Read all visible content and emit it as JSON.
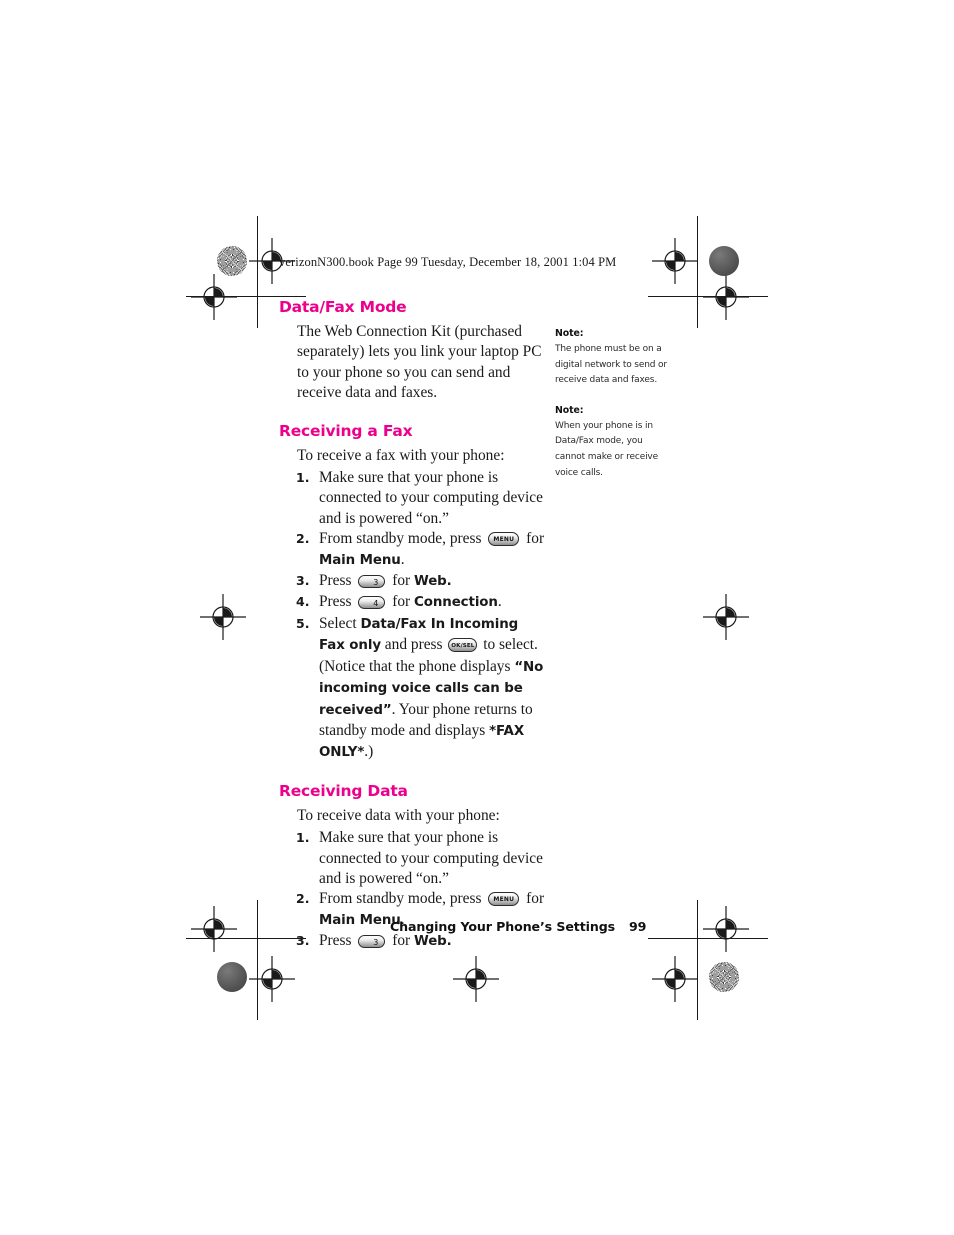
{
  "print_slug": "verizonN300.book  Page 99  Tuesday, December 18, 2001  1:04 PM",
  "accent_color": "#ec008c",
  "sections": [
    {
      "heading": "Data/Fax Mode",
      "intro": "The Web Connection Kit (purchased separately) lets you link your laptop PC to your phone so you can send and receive data and faxes."
    },
    {
      "heading": "Receiving a Fax",
      "intro": "To receive a fax with your phone:",
      "steps": [
        {
          "text_1": "Make sure that your phone is connected to your computing device and is powered “on.”"
        },
        {
          "text_1": "From standby mode, press ",
          "key": "MENU",
          "text_2": " for ",
          "bold_1": "Main Menu",
          "text_3": "."
        },
        {
          "text_1": "Press ",
          "key": "3",
          "text_2": " for ",
          "bold_1": "Web."
        },
        {
          "text_1": "Press ",
          "key": "4",
          "text_2": " for ",
          "bold_1": "Connection",
          "text_3": "."
        },
        {
          "text_1": "Select ",
          "bold_1": "Data/Fax In Incoming Fax only",
          "text_2": " and press ",
          "key": "OK/SEL",
          "text_3": " to select. (Notice that the phone displays ",
          "bold_2": "“No incoming voice calls can be received”",
          "text_4": ". Your phone returns to standby mode and displays ",
          "bold_3": "*FAX ONLY*",
          "text_5": ".)"
        }
      ]
    },
    {
      "heading": "Receiving Data",
      "intro": "To receive data with your phone:",
      "steps": [
        {
          "text_1": "Make sure that your phone is connected to your computing device and is powered “on.”"
        },
        {
          "text_1": "From standby mode, press ",
          "key": "MENU",
          "text_2": " for ",
          "bold_1": "Main Menu",
          "text_3": "."
        },
        {
          "text_1": "Press ",
          "key": "3",
          "text_2": " for ",
          "bold_1": "Web."
        }
      ]
    }
  ],
  "notes": [
    {
      "label": "Note:",
      "text": "The phone must be on a digital network to send or receive data and faxes."
    },
    {
      "label": "Note:",
      "text": "When your phone is in Data/Fax mode, you cannot make or receive voice calls."
    }
  ],
  "footer": {
    "running_head": "Changing Your Phone’s Settings",
    "page_number": "99"
  },
  "keys": {
    "menu_label": "MENU",
    "oksel_label": "OK/SEL",
    "three_label": "3",
    "four_label": "4"
  }
}
